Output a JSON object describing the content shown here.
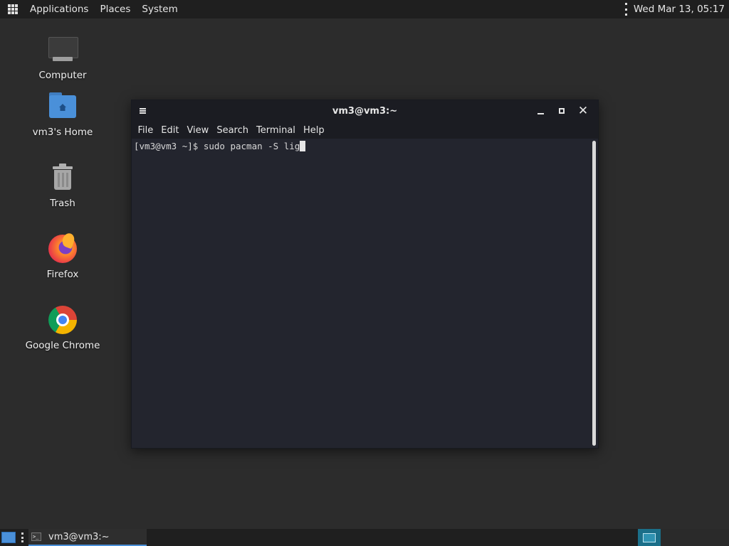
{
  "top_panel": {
    "menus": [
      "Applications",
      "Places",
      "System"
    ],
    "clock": "Wed Mar 13, 05:17"
  },
  "desktop": {
    "icons": [
      {
        "label": "Computer",
        "icon": "computer-icon"
      },
      {
        "label": "vm3's Home",
        "icon": "home-folder-icon"
      },
      {
        "label": "Trash",
        "icon": "trash-icon"
      },
      {
        "label": "Firefox",
        "icon": "firefox-icon"
      },
      {
        "label": "Google Chrome",
        "icon": "chrome-icon"
      }
    ]
  },
  "terminal": {
    "title": "vm3@vm3:~",
    "menu": [
      "File",
      "Edit",
      "View",
      "Search",
      "Terminal",
      "Help"
    ],
    "prompt": "[vm3@vm3 ~]$ ",
    "command": "sudo pacman -S lig"
  },
  "bottom_panel": {
    "task_label": "vm3@vm3:~",
    "task_icon_glyph": ">_"
  },
  "colors": {
    "desktop_bg": "#2c2c2c",
    "panel_bg": "#1f1f1f",
    "terminal_bg": "#23252e",
    "accent": "#4a90d9",
    "workspace_active": "#1b6f89"
  }
}
